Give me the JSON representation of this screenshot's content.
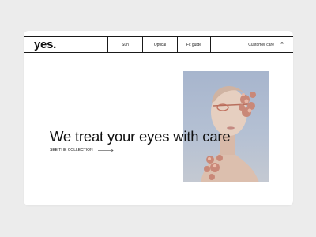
{
  "brand": {
    "logo": "yes."
  },
  "nav": {
    "items": [
      {
        "label": "Sun"
      },
      {
        "label": "Optical"
      },
      {
        "label": "Fit guide"
      }
    ],
    "customer_care": "Customer care",
    "cart_icon": "shopping-bag-icon"
  },
  "hero": {
    "headline": "We treat your eyes with care",
    "cta_label": "SEE THE COLLECTION",
    "cta_icon": "arrow-right-icon",
    "image_desc_colors": {
      "background": "#b4c0d3",
      "flowers": "#c9877a",
      "skin": "#e3c8b8"
    }
  },
  "colors": {
    "page_background": "#ececec",
    "card": "#ffffff",
    "text": "#111111"
  }
}
